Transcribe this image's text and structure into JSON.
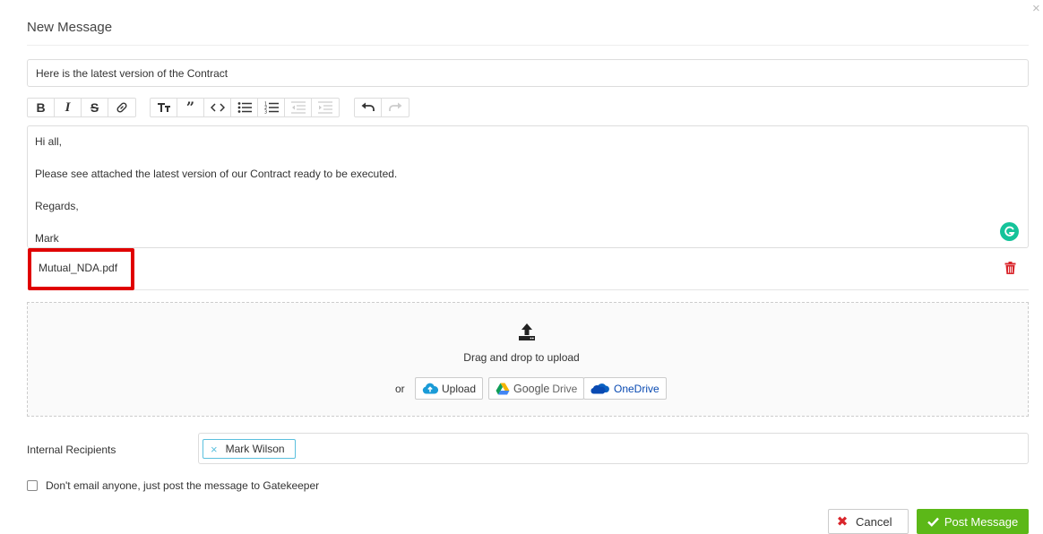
{
  "dialog": {
    "title": "New Message",
    "close_glyph": "×"
  },
  "subject": {
    "value": "Here is the latest version of the Contract"
  },
  "toolbar": {
    "groups": [
      [
        "bold-icon",
        "italic-icon",
        "strikethrough-icon",
        "link-icon"
      ],
      [
        "heading-icon",
        "blockquote-icon",
        "code-icon",
        "bullet-list-icon",
        "numbered-list-icon",
        "outdent-icon",
        "indent-icon"
      ],
      [
        "undo-icon",
        "redo-icon"
      ]
    ]
  },
  "editor": {
    "lines": [
      "Hi all,",
      "Please see attached the latest version of our Contract ready to be executed.",
      "Regards,",
      "Mark"
    ]
  },
  "attachment": {
    "filename": "Mutual_NDA.pdf",
    "highlight_color": "#e00000",
    "delete_color": "#d9262c"
  },
  "upload": {
    "drag_text": "Drag and drop to upload",
    "or_text": "or",
    "upload_label": "Upload",
    "google_drive_label": "Google",
    "google_drive_suffix": "Drive",
    "onedrive_label": "OneDrive"
  },
  "recipients": {
    "label": "Internal Recipients",
    "chips": [
      {
        "name": "Mark Wilson",
        "remove_glyph": "×"
      }
    ],
    "chip_color": "#5bc0de"
  },
  "options": {
    "no_email_label": "Don't email anyone, just post the message to Gatekeeper",
    "no_email_checked": false
  },
  "actions": {
    "cancel_label": "Cancel",
    "cancel_glyph": "✖",
    "post_label": "Post Message",
    "post_color": "#5cb818"
  },
  "colors": {
    "grammarly": "#15c39a",
    "onedrive_blue": "#094ab2"
  }
}
